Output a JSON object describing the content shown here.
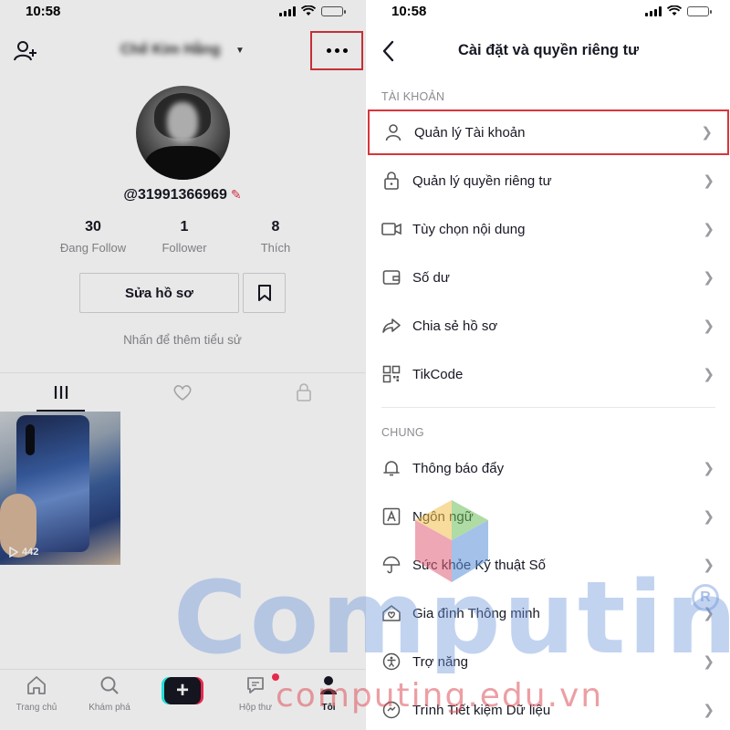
{
  "status": {
    "time": "10:58"
  },
  "profile": {
    "username": "Chế Kim Hằng",
    "handle": "@31991366969",
    "stats": [
      {
        "value": "30",
        "label": "Đang Follow"
      },
      {
        "value": "1",
        "label": "Follower"
      },
      {
        "value": "8",
        "label": "Thích"
      }
    ],
    "edit_label": "Sửa hồ sơ",
    "bio_hint": "Nhấn để thêm tiểu sử",
    "video_views": "442"
  },
  "bottom_nav": [
    {
      "label": "Trang chủ",
      "icon": "home-icon"
    },
    {
      "label": "Khám phá",
      "icon": "search-icon"
    },
    {
      "label": "",
      "icon": "plus-icon"
    },
    {
      "label": "Hộp thư",
      "icon": "inbox-icon"
    },
    {
      "label": "Tôi",
      "icon": "profile-icon"
    }
  ],
  "settings": {
    "title": "Cài đặt và quyền riêng tư",
    "account_section": "TÀI KHOẢN",
    "account_items": [
      {
        "label": "Quản lý Tài khoản",
        "icon": "person-icon"
      },
      {
        "label": "Quản lý quyền riêng tư",
        "icon": "lock-icon"
      },
      {
        "label": "Tùy chọn nội dung",
        "icon": "video-icon"
      },
      {
        "label": "Số dư",
        "icon": "wallet-icon"
      },
      {
        "label": "Chia sẻ hồ sơ",
        "icon": "share-icon"
      },
      {
        "label": "TikCode",
        "icon": "qr-code-icon"
      }
    ],
    "general_section": "CHUNG",
    "general_items": [
      {
        "label": "Thông báo đẩy",
        "icon": "bell-icon"
      },
      {
        "label": "Ngôn ngữ",
        "icon": "language-icon"
      },
      {
        "label": "Sức khỏe Kỹ thuật Số",
        "icon": "umbrella-icon"
      },
      {
        "label": "Gia đình Thông minh",
        "icon": "family-home-icon"
      },
      {
        "label": "Trợ năng",
        "icon": "accessibility-icon"
      },
      {
        "label": "Trình Tiết kiệm Dữ liệu",
        "icon": "data-saver-icon"
      }
    ]
  },
  "watermark": {
    "main": "Computing",
    "sub": "computing.edu.vn",
    "mark": "R"
  },
  "colors": {
    "highlight": "#d9343c",
    "accent_red": "#fe2c55",
    "accent_cyan": "#25f4ee",
    "text": "#161823",
    "muted": "#8a8b91"
  }
}
